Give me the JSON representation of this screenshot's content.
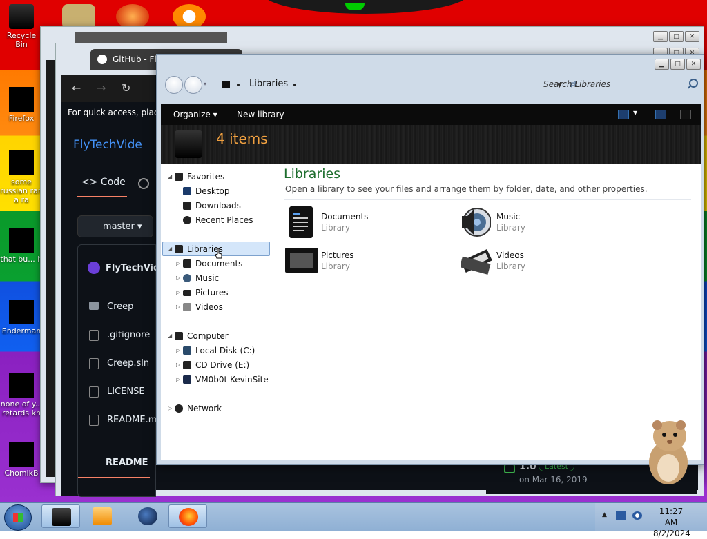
{
  "desktop": {
    "icons": [
      {
        "label": "Recycle Bin"
      },
      {
        "label": "Firefox"
      },
      {
        "label": "some russian ran a ra"
      },
      {
        "label": "that bu... it"
      },
      {
        "label": "Enderman"
      },
      {
        "label": "none of y... retards kn"
      },
      {
        "label": "ChomikB"
      }
    ]
  },
  "github_window": {
    "tab_title": "GitHub - Fly",
    "quick_access_text": "For quick access, place y",
    "repo_name": "FlyTechVide",
    "code_tab": "Code",
    "branch": "master",
    "owner": "FlyTechVide",
    "files": [
      "Creep",
      ".gitignore",
      "Creep.sln",
      "LICENSE",
      "README.m"
    ],
    "readme_label": "README",
    "release": {
      "version": "1.0",
      "badge": "Latest",
      "date": "on Mar 16, 2019"
    }
  },
  "explorer": {
    "address": {
      "location": "Libraries"
    },
    "search_placeholder": "Search Libraries",
    "toolbar": {
      "organize": "Organize",
      "new_library": "New library"
    },
    "header": {
      "item_count": "4 items"
    },
    "nav": {
      "favorites": {
        "label": "Favorites",
        "children": [
          "Desktop",
          "Downloads",
          "Recent Places"
        ]
      },
      "libraries": {
        "label": "Libraries",
        "children": [
          "Documents",
          "Music",
          "Pictures",
          "Videos"
        ]
      },
      "computer": {
        "label": "Computer",
        "children": [
          "Local Disk (C:)",
          "CD Drive (E:)",
          "VM0b0t KevinSite"
        ]
      },
      "network": {
        "label": "Network"
      }
    },
    "main": {
      "title": "Libraries",
      "subtitle": "Open a library to see your files and arrange them by folder, date, and other properties.",
      "items": [
        {
          "name": "Documents",
          "type": "Library",
          "icon": "documents-icon"
        },
        {
          "name": "Music",
          "type": "Library",
          "icon": "music-icon"
        },
        {
          "name": "Pictures",
          "type": "Library",
          "icon": "pictures-icon"
        },
        {
          "name": "Videos",
          "type": "Library",
          "icon": "videos-icon"
        }
      ]
    }
  },
  "taskbar": {
    "clock": {
      "time": "11:27 AM",
      "date": "8/2/2024"
    },
    "apps": [
      "explorer",
      "media-player",
      "globe",
      "firefox"
    ]
  },
  "colors": {
    "accent_green": "#1e6e2e",
    "item_count_orange": "#f0a040",
    "github_link": "#4493f8"
  }
}
